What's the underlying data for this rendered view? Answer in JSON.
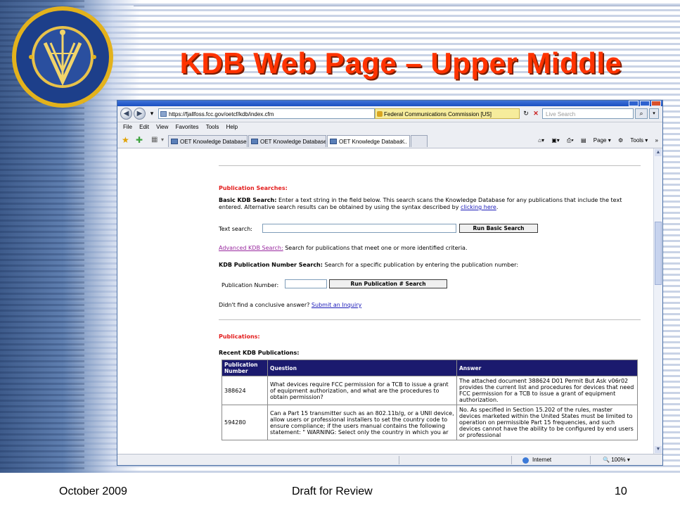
{
  "slide": {
    "title": "KDB Web Page – Upper Middle",
    "footer_left": "October 2009",
    "footer_center": "Draft for Review",
    "page_number": "10"
  },
  "seal": {
    "text_top": "FEDERAL COMMUNICATIONS",
    "text_bottom": "COMMISSION"
  },
  "browser": {
    "url": "https://fjallfoss.fcc.gov/oetcf/kdb/index.cfm",
    "certificate": "Federal Communications Commission [US]",
    "search_placeholder": "Live Search",
    "menu": [
      "File",
      "Edit",
      "View",
      "Favorites",
      "Tools",
      "Help"
    ],
    "tabs": [
      {
        "label": "OET Knowledge Database (K..."
      },
      {
        "label": "OET Knowledge Database (K..."
      },
      {
        "label": "OET Knowledge Databas..."
      }
    ],
    "cmd_page": "Page",
    "cmd_tools": "Tools",
    "status_zone": "Internet",
    "status_zoom": "100%"
  },
  "page": {
    "publication_searches_heading": "Publication Searches:",
    "basic_label": "Basic KDB Search:",
    "basic_text": " Enter a text string in the field below. This search scans the Knowledge Database for any publications that include the text entered. Alternative search results can be obtained by using the syntax described by ",
    "basic_link": "clicking here",
    "text_search_label": "Text search:",
    "run_basic_button": "Run Basic Search",
    "advanced_link": "Advanced KDB Search:",
    "advanced_text": " Search for publications that meet one or more identified criteria.",
    "pubnum_label_bold": "KDB Publication Number Search:",
    "pubnum_text": " Search for a specific publication by entering the publication number:",
    "pubnum_field_label": "Publication Number:",
    "run_pub_button": "Run Publication # Search",
    "inquiry_text": "Didn't find a conclusive answer? ",
    "inquiry_link": "Submit an Inquiry",
    "publications_heading": "Publications:",
    "recent_heading": "Recent KDB Publications:",
    "table": {
      "headers": [
        "Publication Number",
        "Question",
        "Answer"
      ],
      "rows": [
        {
          "number": "388624",
          "question": "What devices require FCC permission for a TCB to issue a grant of equipment authorization, and what are the procedures to obtain permission?",
          "answer": "The attached document 388624 D01 Permit But Ask v06r02 provides the current list and procedures for devices that need FCC permission for a TCB to issue a grant of equipment authorization."
        },
        {
          "number": "594280",
          "question": "Can a Part 15 transmitter such as an 802.11b/g, or a UNII device, allow users or professional installers to set the country code to ensure compliance; if the users manual contains the following statement: \" WARNING: Select only the country in which you ar",
          "answer": "No. As specified in Section 15.202 of the rules, master devices marketed within the United States must be limited to operation on permissible Part 15 frequencies, and such devices cannot have the ability to be configured by end users or professional"
        }
      ]
    }
  }
}
